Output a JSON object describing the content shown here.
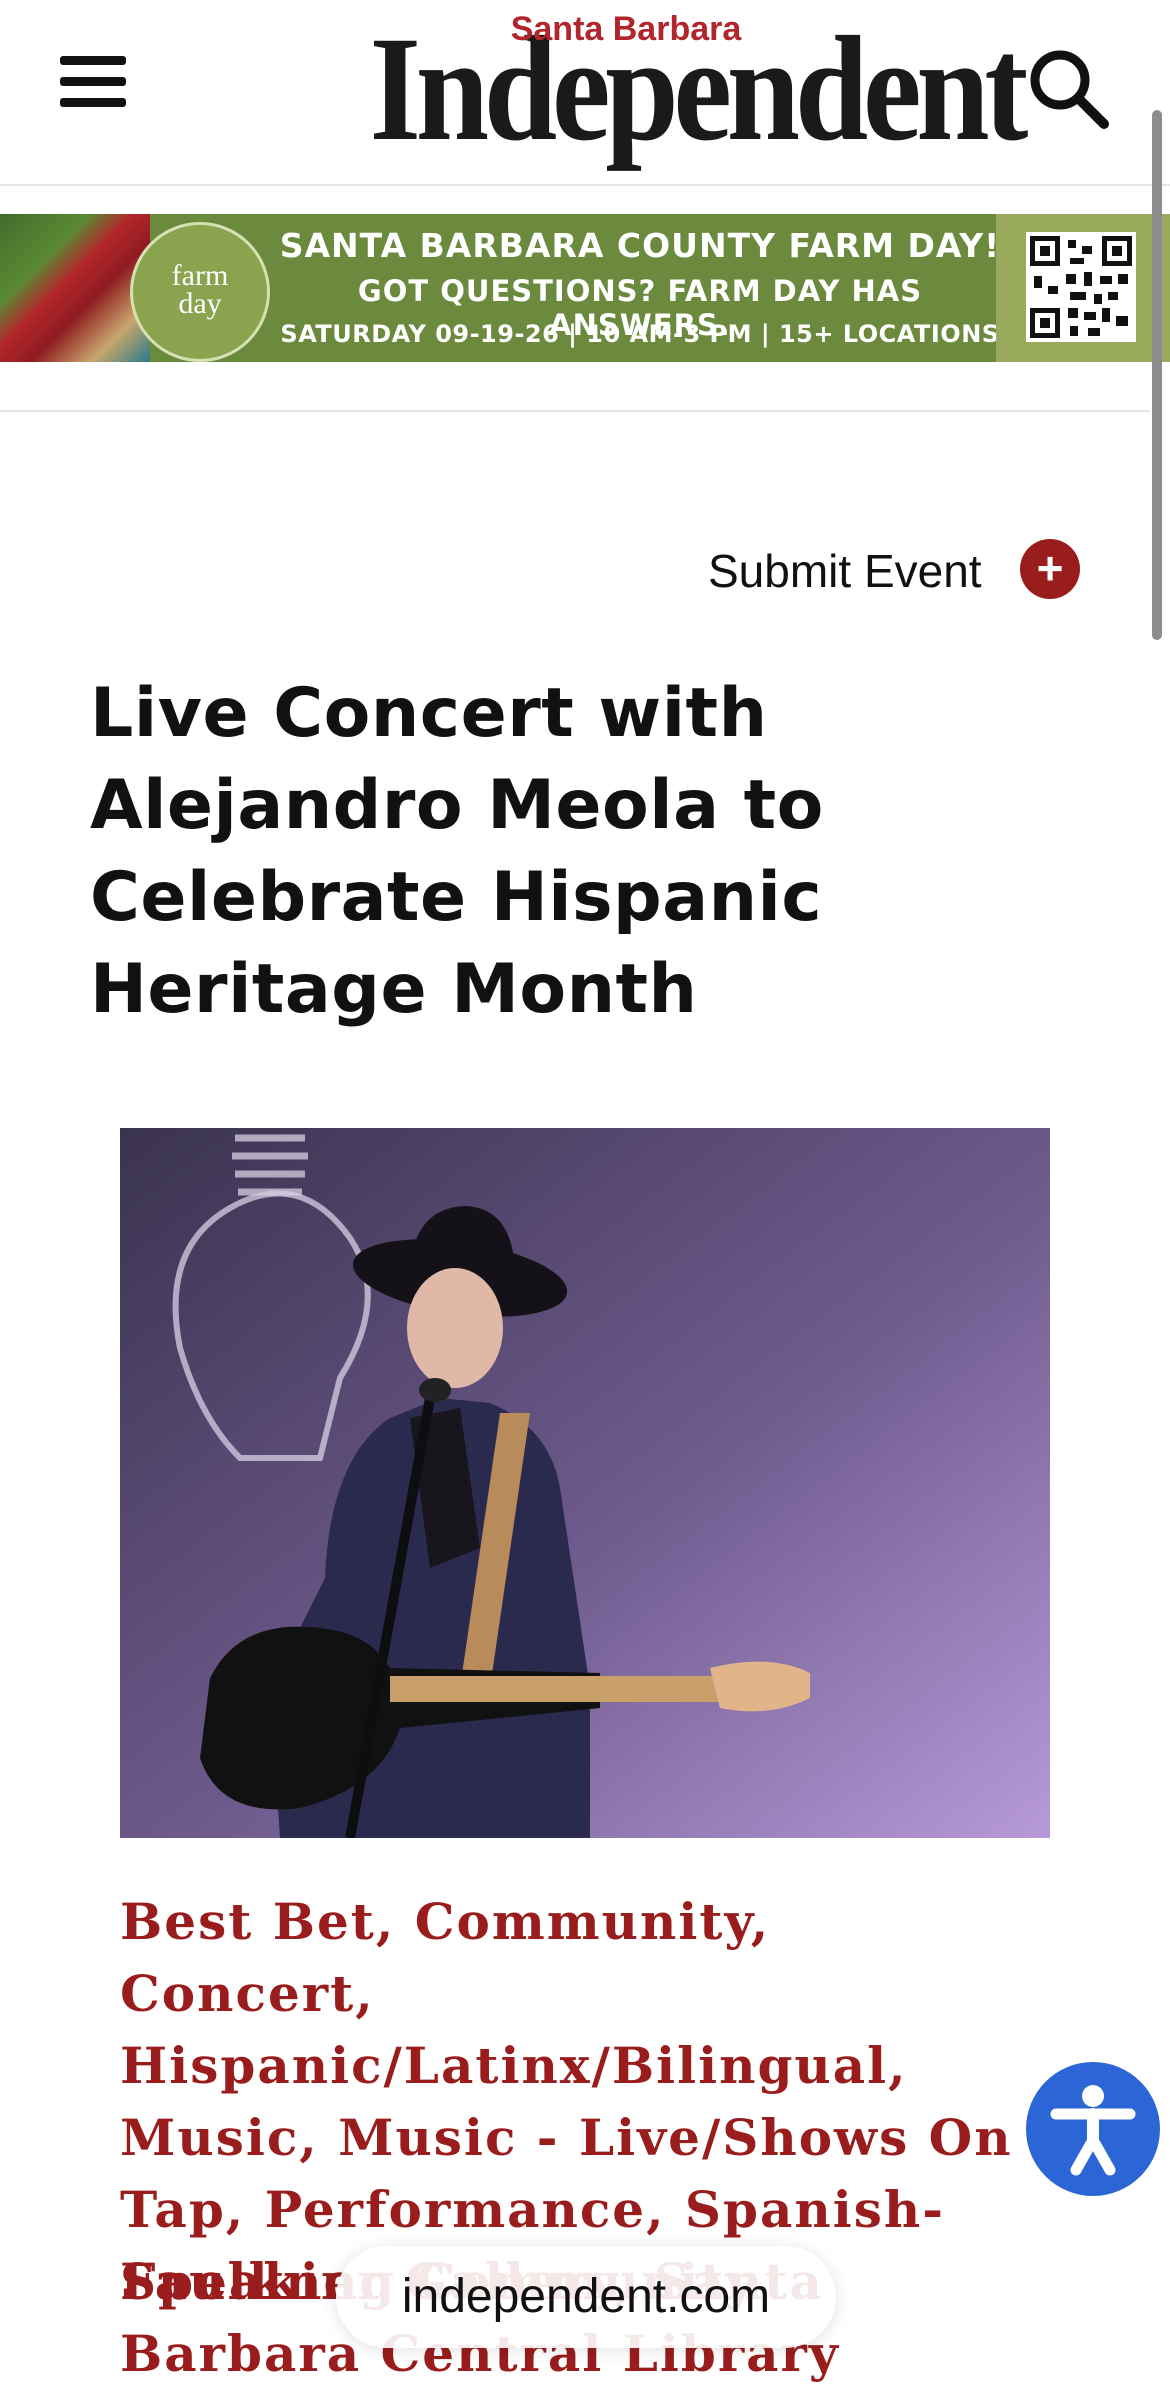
{
  "header": {
    "logo_top": "Santa Barbara",
    "logo_main": "Independent",
    "menu_icon": "hamburger-menu-icon",
    "search_icon": "search-icon"
  },
  "ad": {
    "badge_farm": "farm",
    "badge_day": "day",
    "line1": "SANTA BARBARA COUNTY FARM DAY!",
    "line2": "GOT QUESTIONS? FARM DAY HAS ANSWERS.",
    "line3": "SATURDAY 09-19-26 | 10 AM-3 PM | 15+ LOCATIONS",
    "qr_icon": "qr-code-icon"
  },
  "submit": {
    "label": "Submit Event",
    "plus": "+"
  },
  "event": {
    "title": "Live Concert with Alejandro Meola to Celebrate Hispanic Heritage Month",
    "categories": "Best Bet, Community, Concert, Hispanic/Latinx/Bilingual, Music, Music - Live/Shows On Tap, Performance, Spanish-Speaking Community",
    "venue": "Faulkner Gallery, Santa Barbara Central Library"
  },
  "browser": {
    "url": "independent.com"
  },
  "colors": {
    "accent": "#9a1d1d",
    "ad_green": "#6b8a3e",
    "a11y_blue": "#2c66d6"
  }
}
